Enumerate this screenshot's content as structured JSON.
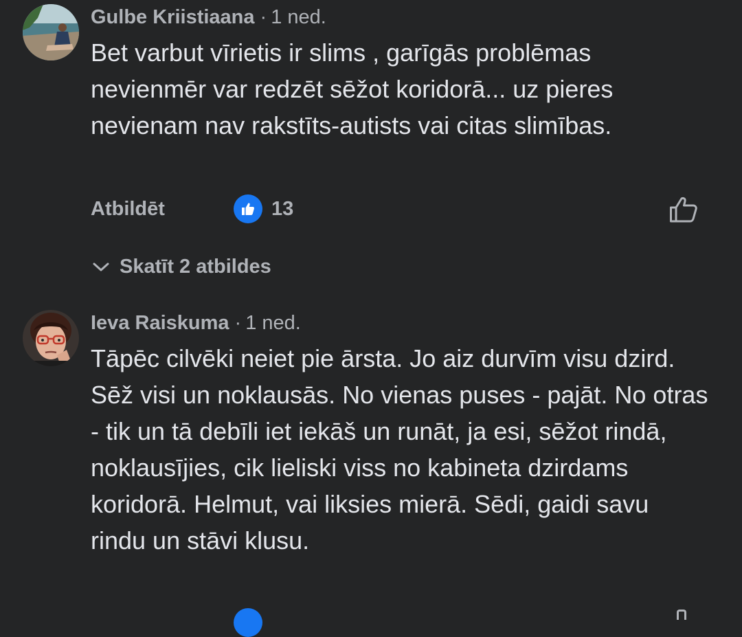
{
  "comments": [
    {
      "author": "Gulbe Kriistiaana",
      "separator": "·",
      "time": "1 ned.",
      "text": "Bet varbut vīrietis ir slims , garīgās problēmas nevienmēr var redzēt sēžot koridorā... uz pieres nevienam nav rakstīts-autists vai citas slimības.",
      "reply_label": "Atbildēt",
      "reaction_icon": "like-icon",
      "reaction_count": "13",
      "view_replies_label": "Skatīt 2 atbildes"
    },
    {
      "author": "Ieva Raiskuma",
      "separator": "·",
      "time": "1 ned.",
      "text": "Tāpēc cilvēki neiet pie ārsta. Jo aiz durvīm visu dzird. Sēž visi un noklausās. No vienas puses - pajāt. No otras - tik un tā debīli iet iekāš un runāt, ja esi, sēžot rindā, noklausījies, cik lieliski viss no kabineta dzirdams koridorā. Helmut, vai liksies mierā. Sēdi, gaidi savu rindu un stāvi klusu."
    }
  ],
  "colors": {
    "background": "#242526",
    "primary_text": "#e4e6eb",
    "secondary_text": "#b0b3b8",
    "like_blue": "#1877f2"
  }
}
